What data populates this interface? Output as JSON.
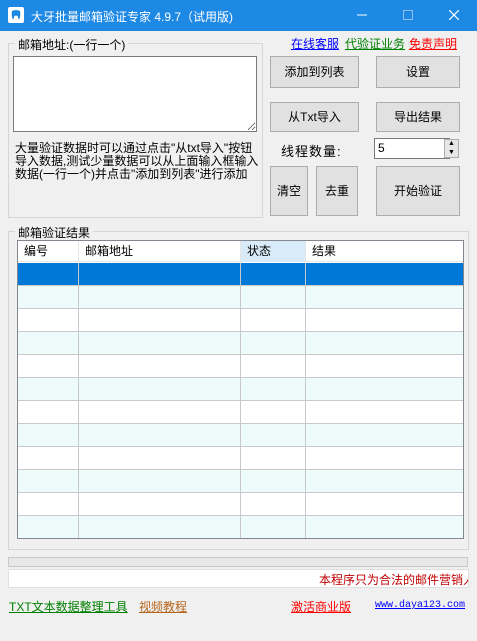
{
  "window": {
    "title": "大牙批量邮箱验证专家 4.9.7（试用版)",
    "title_color": "#1e88e5"
  },
  "email_group": {
    "legend": "邮箱地址:(一行一个)",
    "value": "",
    "hint": "大量验证数据时可以通过点击\"从txt导入\"按钮导入数据,测试少量数据可以从上面输入框输入数据(一行一个)并点击\"添加到列表\"进行添加"
  },
  "top_links": [
    {
      "label": "在线客服",
      "color": "#0000ff"
    },
    {
      "label": "代验证业务",
      "color": "#008000"
    },
    {
      "label": "免责声明",
      "color": "#ff0000"
    }
  ],
  "buttons": {
    "add_to_list": "添加到列表",
    "settings": "设置",
    "import_txt": "从Txt导入",
    "export_results": "导出结果",
    "clear": "清空",
    "dedupe": "去重",
    "start": "开始验证"
  },
  "thread": {
    "label": "线程数量:",
    "value": "5"
  },
  "results": {
    "legend": "邮箱验证结果",
    "columns": [
      "编号",
      "邮箱地址",
      "状态",
      "结果"
    ],
    "selected_row": 0,
    "row_count": 12,
    "row_colors": {
      "selected": "#0078d7",
      "alt": "#eefbfb",
      "normal": "#ffffff"
    }
  },
  "marquee": {
    "text": "本程序只为合法的邮件营销人员设计"
  },
  "bottom_links": [
    {
      "label": "TXT文本数据整理工具",
      "color": "#008000"
    },
    {
      "label": "视频教程",
      "color": "#b5651d"
    },
    {
      "label": "激活商业版",
      "color": "#ff0000"
    },
    {
      "label": "www.daya123.com",
      "color": "#0000ff"
    }
  ]
}
